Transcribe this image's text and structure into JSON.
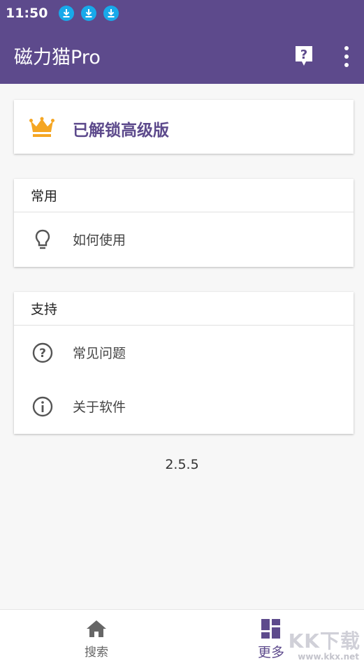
{
  "status_bar": {
    "time": "11:50"
  },
  "app_bar": {
    "title": "磁力猫Pro"
  },
  "premium": {
    "label": "已解锁高级版"
  },
  "groups": [
    {
      "header": "常用",
      "items": [
        {
          "label": "如何使用",
          "icon": "lightbulb-icon"
        }
      ]
    },
    {
      "header": "支持",
      "items": [
        {
          "label": "常见问题",
          "icon": "question-circle-icon"
        },
        {
          "label": "关于软件",
          "icon": "info-circle-icon"
        }
      ]
    }
  ],
  "version": "2.5.5",
  "bottom_nav": {
    "items": [
      {
        "label": "搜索",
        "icon": "home-icon"
      },
      {
        "label": "更多",
        "icon": "dashboard-icon",
        "active": true
      }
    ]
  },
  "watermark": {
    "text": "KK下载",
    "url": "www.kkx.net"
  },
  "colors": {
    "primary": "#5d4a8c",
    "crown": "#f5a623",
    "download_badge": "#18a9ea",
    "background": "#f7f7f7"
  }
}
